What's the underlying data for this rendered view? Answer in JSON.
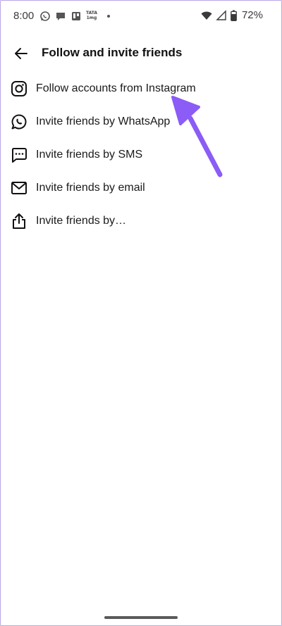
{
  "status_bar": {
    "time": "8:00",
    "carrier_badge": "TATA 1mg",
    "battery_percent": "72%",
    "icons": [
      "whatsapp-icon",
      "chat-bubble-icon",
      "trello-icon",
      "tata-1mg-icon",
      "notification-dot-icon",
      "wifi-icon",
      "cellular-signal-icon",
      "battery-icon"
    ]
  },
  "header": {
    "title": "Follow and invite friends",
    "back_icon": "arrow-left-icon"
  },
  "menu": {
    "items": [
      {
        "label": "Follow accounts from Instagram",
        "icon": "instagram-icon"
      },
      {
        "label": "Invite friends by WhatsApp",
        "icon": "whatsapp-icon"
      },
      {
        "label": "Invite friends by SMS",
        "icon": "sms-icon"
      },
      {
        "label": "Invite friends by email",
        "icon": "email-icon"
      },
      {
        "label": "Invite friends by…",
        "icon": "share-icon"
      }
    ]
  },
  "colors": {
    "accent_arrow": "#8b5cf6",
    "text": "#111111",
    "background": "#ffffff"
  }
}
